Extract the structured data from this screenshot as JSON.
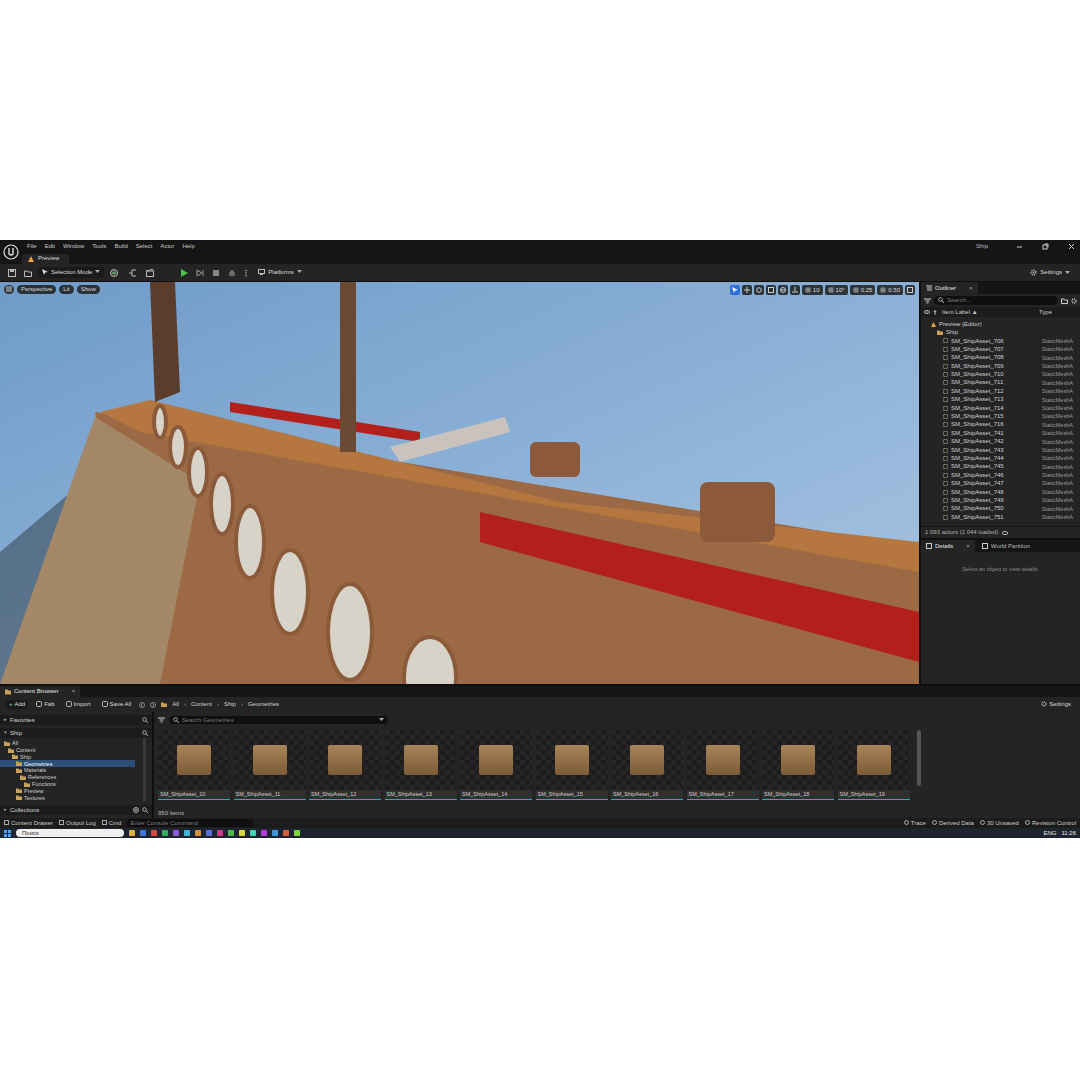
{
  "window": {
    "title": "Ship",
    "menu": [
      "File",
      "Edit",
      "Window",
      "Tools",
      "Build",
      "Select",
      "Actor",
      "Help"
    ]
  },
  "level_tab": {
    "label": "Preview",
    "selected": true
  },
  "toolbar": {
    "mode": "Selection Mode",
    "platforms": "Platforms",
    "settings": "Settings"
  },
  "viewport": {
    "buttons": [
      "Perspective",
      "Lit",
      "Show"
    ],
    "snaps": [
      "10",
      "10°",
      "0.25",
      "0.50"
    ]
  },
  "outliner": {
    "title": "Outliner",
    "close": "×",
    "search_placeholder": "Search...",
    "columns": [
      "Item Label ▲",
      "Type"
    ],
    "rows": [
      {
        "label": "Preview (Editor)",
        "type": "",
        "depth": 0,
        "kind": "world"
      },
      {
        "label": "Ship",
        "type": "",
        "depth": 1,
        "kind": "folder"
      },
      {
        "label": "SM_ShipAsset_706",
        "type": "StaticMeshA",
        "depth": 2,
        "kind": "mesh"
      },
      {
        "label": "SM_ShipAsset_707",
        "type": "StaticMeshA",
        "depth": 2,
        "kind": "mesh"
      },
      {
        "label": "SM_ShipAsset_708",
        "type": "StaticMeshA",
        "depth": 2,
        "kind": "mesh"
      },
      {
        "label": "SM_ShipAsset_709",
        "type": "StaticMeshA",
        "depth": 2,
        "kind": "mesh"
      },
      {
        "label": "SM_ShipAsset_710",
        "type": "StaticMeshA",
        "depth": 2,
        "kind": "mesh"
      },
      {
        "label": "SM_ShipAsset_711",
        "type": "StaticMeshA",
        "depth": 2,
        "kind": "mesh"
      },
      {
        "label": "SM_ShipAsset_712",
        "type": "StaticMeshA",
        "depth": 2,
        "kind": "mesh"
      },
      {
        "label": "SM_ShipAsset_713",
        "type": "StaticMeshA",
        "depth": 2,
        "kind": "mesh"
      },
      {
        "label": "SM_ShipAsset_714",
        "type": "StaticMeshA",
        "depth": 2,
        "kind": "mesh"
      },
      {
        "label": "SM_ShipAsset_715",
        "type": "StaticMeshA",
        "depth": 2,
        "kind": "mesh"
      },
      {
        "label": "SM_ShipAsset_716",
        "type": "StaticMeshA",
        "depth": 2,
        "kind": "mesh"
      },
      {
        "label": "SM_ShipAsset_741",
        "type": "StaticMeshA",
        "depth": 2,
        "kind": "mesh"
      },
      {
        "label": "SM_ShipAsset_742",
        "type": "StaticMeshA",
        "depth": 2,
        "kind": "mesh"
      },
      {
        "label": "SM_ShipAsset_743",
        "type": "StaticMeshA",
        "depth": 2,
        "kind": "mesh"
      },
      {
        "label": "SM_ShipAsset_744",
        "type": "StaticMeshA",
        "depth": 2,
        "kind": "mesh"
      },
      {
        "label": "SM_ShipAsset_745",
        "type": "StaticMeshA",
        "depth": 2,
        "kind": "mesh"
      },
      {
        "label": "SM_ShipAsset_746",
        "type": "StaticMeshA",
        "depth": 2,
        "kind": "mesh"
      },
      {
        "label": "SM_ShipAsset_747",
        "type": "StaticMeshA",
        "depth": 2,
        "kind": "mesh"
      },
      {
        "label": "SM_ShipAsset_748",
        "type": "StaticMeshA",
        "depth": 2,
        "kind": "mesh"
      },
      {
        "label": "SM_ShipAsset_749",
        "type": "StaticMeshA",
        "depth": 2,
        "kind": "mesh"
      },
      {
        "label": "SM_ShipAsset_750",
        "type": "StaticMeshA",
        "depth": 2,
        "kind": "mesh"
      },
      {
        "label": "SM_ShipAsset_751",
        "type": "StaticMeshA",
        "depth": 2,
        "kind": "mesh"
      }
    ],
    "footer": "1 093 actors (1 044 loaded)"
  },
  "details": {
    "tabs": [
      {
        "label": "Details",
        "selected": true,
        "close": "×"
      },
      {
        "label": "World Partition",
        "selected": false,
        "close": ""
      }
    ],
    "empty": "Select an object to view details."
  },
  "content_browser": {
    "title": "Content Browser",
    "close": "×",
    "toolbar": [
      "Add",
      "Fab",
      "Import",
      "Save All"
    ],
    "add_symbol": "+",
    "breadcrumb": [
      "All",
      "Content",
      "Ship",
      "Geometries"
    ],
    "separator": "›",
    "settings": "Settings",
    "favorites": "Favorites",
    "root": "Ship",
    "tree": [
      {
        "label": "All",
        "depth": 0,
        "selected": false
      },
      {
        "label": "Content",
        "depth": 1,
        "selected": false
      },
      {
        "label": "Ship",
        "depth": 2,
        "selected": false
      },
      {
        "label": "Geometries",
        "depth": 3,
        "selected": true
      },
      {
        "label": "Materials",
        "depth": 3,
        "selected": false
      },
      {
        "label": "References",
        "depth": 4,
        "selected": false
      },
      {
        "label": "Functions",
        "depth": 5,
        "selected": false
      },
      {
        "label": "Preview",
        "depth": 3,
        "selected": false
      },
      {
        "label": "Textures",
        "depth": 3,
        "selected": false
      }
    ],
    "collections": "Collections",
    "search_placeholder": "Search Geometries",
    "assets": [
      "SM_ShipAsset_10",
      "SM_ShipAsset_11",
      "SM_ShipAsset_12",
      "SM_ShipAsset_13",
      "SM_ShipAsset_14",
      "SM_ShipAsset_15",
      "SM_ShipAsset_16",
      "SM_ShipAsset_17",
      "SM_ShipAsset_18",
      "SM_ShipAsset_19"
    ],
    "count": "950 items"
  },
  "status_bar": {
    "items": [
      "Content Drawer",
      "Output Log",
      "Cmd"
    ],
    "console_placeholder": "Enter Console Command",
    "right": [
      "Trace",
      "Derived Data",
      "30 Unsaved",
      "Revision Control"
    ]
  },
  "taskbar": {
    "search": "Поиск",
    "language": "ENG",
    "time": "11:26"
  }
}
